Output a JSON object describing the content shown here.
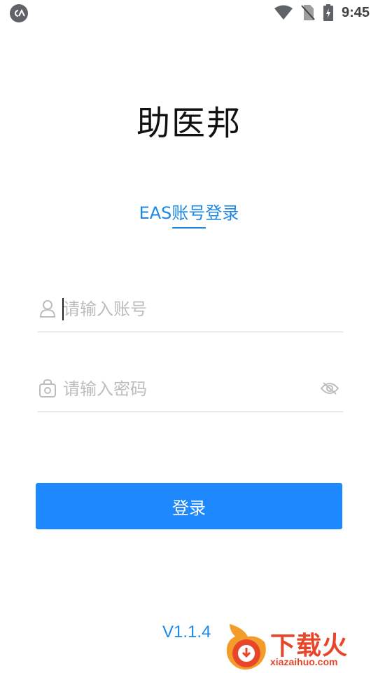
{
  "status_bar": {
    "time": "9:45"
  },
  "app": {
    "title": "助医邦"
  },
  "login_tab": {
    "label": "EAS账号登录"
  },
  "form": {
    "account_placeholder": "请输入账号",
    "account_value": "",
    "password_placeholder": "请输入密码",
    "password_value": ""
  },
  "login_button": {
    "label": "登录"
  },
  "version": "V1.1.4",
  "watermark": {
    "brand_cn": "下载火",
    "brand_en": "xiazaihuo.com"
  },
  "colors": {
    "accent": "#1e88e5",
    "button": "#1e88ff",
    "watermark": "#e8462a"
  },
  "icons": [
    "app-indicator-icon",
    "wifi-icon",
    "no-sim-icon",
    "battery-charging-icon",
    "user-icon",
    "lock-icon",
    "eye-icon",
    "flame-logo-icon"
  ]
}
